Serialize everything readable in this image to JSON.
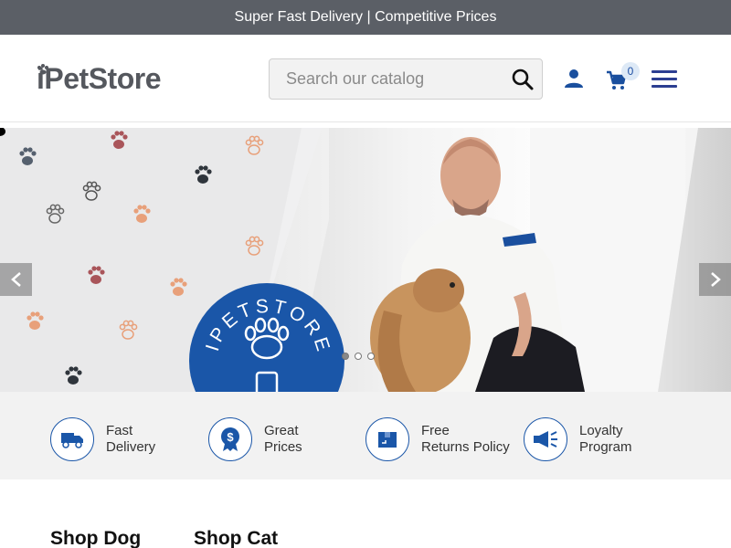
{
  "topbar": {
    "text": "Super Fast Delivery | Competitive Prices"
  },
  "header": {
    "logo_text": "PetStore",
    "logo_prefix": "i",
    "search_placeholder": "Search our catalog",
    "cart_count": "0"
  },
  "hero": {
    "badge_text": "IPETSTORE",
    "slides": 3,
    "active_slide": 1
  },
  "features": [
    {
      "line1": "Fast",
      "line2": "Delivery",
      "icon": "delivery-truck-icon"
    },
    {
      "line1": "Great",
      "line2": "Prices",
      "icon": "price-badge-icon"
    },
    {
      "line1": "Free",
      "line2": "Returns Policy",
      "icon": "returns-box-icon"
    },
    {
      "line1": "Loyalty",
      "line2": "Program",
      "icon": "megaphone-icon"
    }
  ],
  "shop": {
    "dog": "Shop Dog",
    "cat": "Shop Cat"
  },
  "colors": {
    "brand_blue": "#1a56a8",
    "topbar": "#5b5f66",
    "menu": "#2c3e91"
  }
}
